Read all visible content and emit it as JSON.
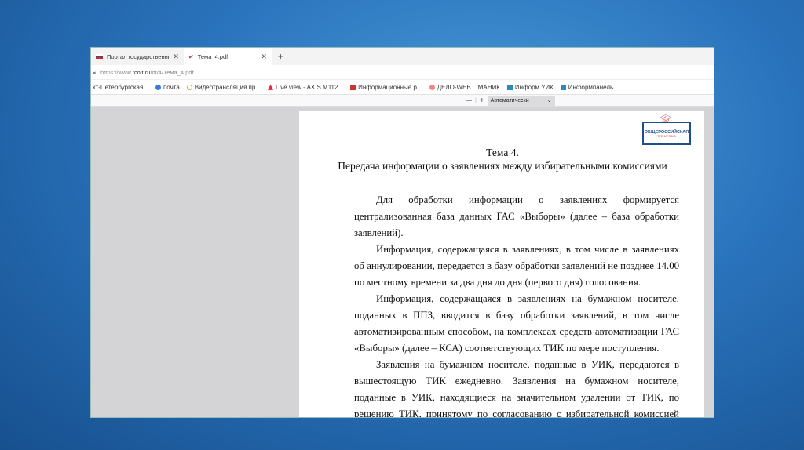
{
  "tabs": [
    {
      "label": "Портал государственных услуг",
      "icon": "russia-flag-icon"
    },
    {
      "label": "Тема_4.pdf",
      "icon": "pdf-icon"
    }
  ],
  "address": {
    "prefix": "https://www.",
    "domain": "rcoit.ru",
    "path": "/ot/4/Тема_4.pdf"
  },
  "bookmarks": [
    "кт-Петербургская...",
    "почта",
    "Видеотрансляция пр...",
    "Live view - AXIS M112...",
    "Информационные р...",
    "ДЕЛО-WEB",
    "МАНИК",
    "Информ УИК",
    "Информпанель"
  ],
  "pdf_toolbar": {
    "zoom_out": "—",
    "zoom_in": "+",
    "zoom_value": "Автоматически"
  },
  "document": {
    "logo_text": "ОБЩЕРОССИЙСКАЯ",
    "logo_sub": "ТРЕНИРОВКА",
    "title": "Тема 4.",
    "subtitle": "Передача информации о заявлениях между избирательными комиссиями",
    "paragraphs": [
      "Для обработки информации о заявлениях формируется централизованная база данных ГАС «Выборы» (далее – база обработки заявлений).",
      "Информация, содержащаяся в заявлениях, в том числе в заявлениях об аннулировании, передается в базу обработки заявлений не позднее 14.00 по местному времени за два дня до дня (первого дня) голосования.",
      "Информация, содержащаяся в заявлениях на бумажном носителе, поданных в ППЗ, вводится в базу обработки заявлений, в том числе автоматизированным способом, на комплексах средств автоматизации ГАС «Выборы» (далее – КСА) соответствующих ТИК по мере поступления.",
      "Заявления на бумажном носителе, поданные в УИК, передаются в вышестоящую ТИК ежедневно. Заявления на бумажном носителе, поданные в УИК, находящиеся на значительном удалении от ТИК, по решению ТИК, принятому по согласованию с избирательной комиссией соответствующего субъекта Российской Федерации, могут передаваться с иной периодичностью."
    ]
  }
}
